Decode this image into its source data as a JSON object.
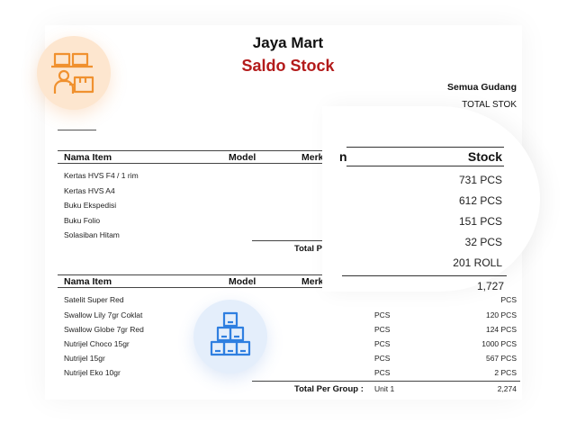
{
  "store_name": "Jaya Mart",
  "report_title": "Saldo Stock",
  "warehouse_label": "Semua Gudang",
  "stock_type_label": "TOTAL STOK",
  "columns": {
    "item": "Nama Item",
    "model": "Model",
    "merk": "Merk"
  },
  "group1": {
    "items": [
      "Kertas HVS F4 / 1 rim",
      "Kertas HVS A4",
      "Buku Ekspedisi",
      "Buku Folio",
      "Solasiban Hitam"
    ],
    "total_label": "Total Per"
  },
  "group2": {
    "items": [
      {
        "name": "Satelit Super Red",
        "unit": "",
        "value": "PCS"
      },
      {
        "name": "Swallow Lily 7gr Coklat",
        "unit": "PCS",
        "value": "120 PCS"
      },
      {
        "name": "Swallow Globe 7gr Red",
        "unit": "PCS",
        "value": "124 PCS"
      },
      {
        "name": "Nutrijel Choco 15gr",
        "unit": "PCS",
        "value": "1000 PCS"
      },
      {
        "name": "Nutrijel 15gr",
        "unit": "PCS",
        "value": "567 PCS"
      },
      {
        "name": "Nutrijel Eko 10gr",
        "unit": "PCS",
        "value": "2 PCS"
      }
    ],
    "total_label": "Total Per Group :",
    "total_unit": "Unit 1",
    "total_value": "2,274"
  },
  "overlay": {
    "name_fragment": "n",
    "stock_header": "Stock",
    "values": [
      "731 PCS",
      "612 PCS",
      "151 PCS",
      "32 PCS",
      "201 ROLL"
    ],
    "total": "1,727"
  },
  "icons": {
    "warehouse": "warehouse-worker-icon",
    "boxes": "stacked-boxes-icon"
  },
  "colors": {
    "title_red": "#b31b1b",
    "orange_icon": "#f0912f",
    "blue_icon": "#2f7fe0"
  }
}
